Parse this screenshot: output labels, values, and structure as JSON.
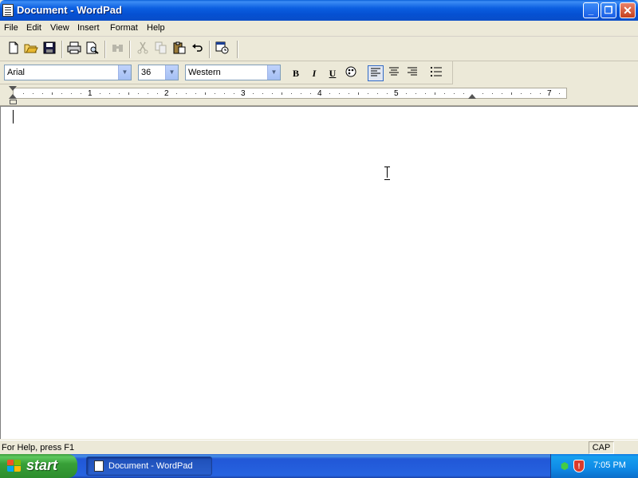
{
  "window": {
    "title": "Document - WordPad",
    "minimize_label": "_",
    "restore_label": "❐",
    "close_label": "✕"
  },
  "menu": [
    "File",
    "Edit",
    "View",
    "Insert",
    "Format",
    "Help"
  ],
  "toolbar": {
    "icons": [
      "new-icon",
      "open-icon",
      "save-icon",
      "print-icon",
      "print-preview-icon",
      "find-icon",
      "cut-icon",
      "copy-icon",
      "paste-icon",
      "undo-icon",
      "date-time-icon"
    ]
  },
  "format_bar": {
    "font": "Arial",
    "size": "36",
    "script": "Western",
    "bold_label": "B",
    "italic_label": "I",
    "underline_label": "U"
  },
  "ruler": {
    "numbers": [
      "1",
      "2",
      "3",
      "4",
      "5",
      "7"
    ]
  },
  "status": {
    "help_text": "For Help, press F1",
    "cap_indicator": "CAP"
  },
  "taskbar": {
    "start_label": "start",
    "task_label": "Document - WordPad",
    "clock": "7:05 PM"
  },
  "colors": {
    "title_blue": "#0550d2",
    "start_green": "#38a038",
    "face": "#ece9d8"
  }
}
